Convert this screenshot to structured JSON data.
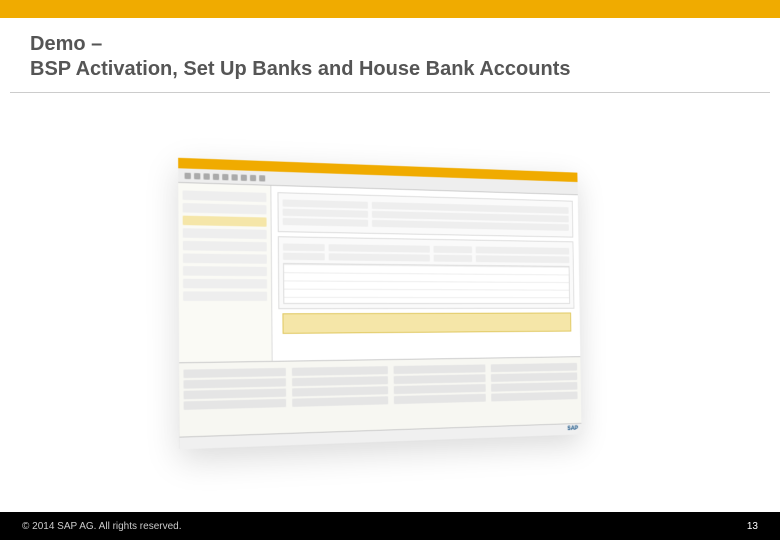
{
  "header": {
    "title_line1": "Demo –",
    "title_line2": "BSP Activation, Set Up Banks and House Bank Accounts"
  },
  "mockup": {
    "logo": "SAP"
  },
  "footer": {
    "copyright": "© 2014 SAP AG. All rights reserved.",
    "page_number": "13"
  }
}
